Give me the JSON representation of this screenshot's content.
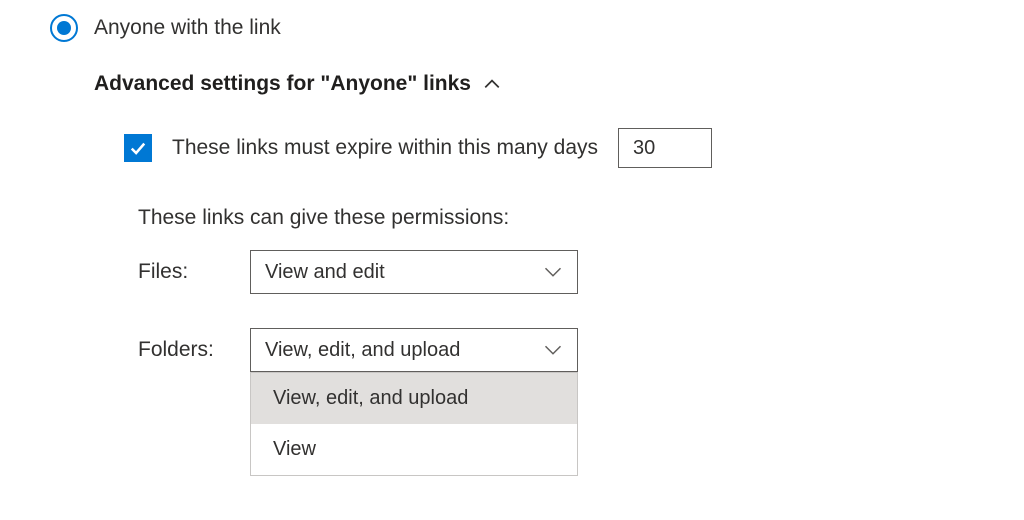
{
  "radio": {
    "label": "Anyone with the link"
  },
  "advanced": {
    "heading": "Advanced settings for \"Anyone\" links"
  },
  "expire": {
    "label": "These links must expire within this many days",
    "value": "30"
  },
  "permissions": {
    "description": "These links can give these permissions:",
    "files": {
      "label": "Files:",
      "value": "View and edit"
    },
    "folders": {
      "label": "Folders:",
      "value": "View, edit, and upload",
      "options": [
        "View, edit, and upload",
        "View"
      ]
    }
  }
}
